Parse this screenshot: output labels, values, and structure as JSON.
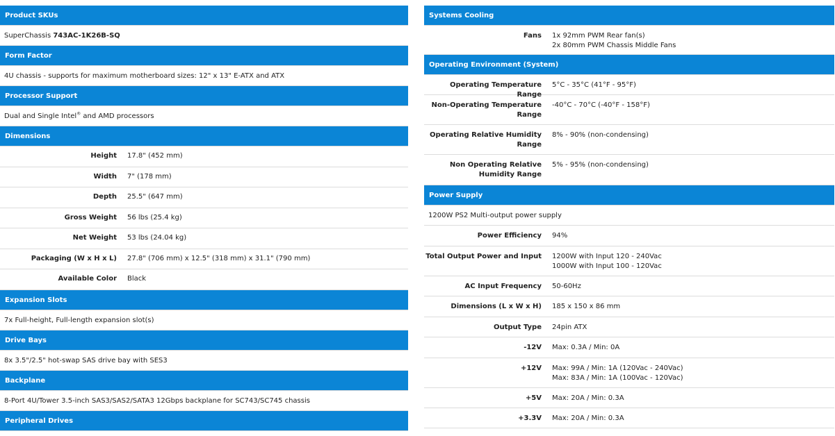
{
  "left": {
    "product_skus": {
      "header": "Product SKUs",
      "prefix": "SuperChassis ",
      "sku": "743AC-1K26B-SQ"
    },
    "form_factor": {
      "header": "Form Factor",
      "text": "4U chassis - supports for maximum motherboard sizes: 12\" x 13\" E-ATX and ATX"
    },
    "processor_support": {
      "header": "Processor Support",
      "text_pre": "Dual and Single Intel",
      "sup": "®",
      "text_post": " and AMD processors"
    },
    "dimensions": {
      "header": "Dimensions",
      "rows": [
        {
          "label": "Height",
          "value": "17.8\" (452 mm)"
        },
        {
          "label": "Width",
          "value": "7\" (178 mm)"
        },
        {
          "label": "Depth",
          "value": "25.5\" (647 mm)"
        },
        {
          "label": "Gross Weight",
          "value": "56 lbs (25.4 kg)"
        },
        {
          "label": "Net Weight",
          "value": "53 lbs (24.04 kg)"
        },
        {
          "label": "Packaging (W x H x L)",
          "value": "27.8\" (706 mm) x 12.5\" (318 mm) x 31.1\" (790 mm)"
        },
        {
          "label": "Available Color",
          "value": "Black"
        }
      ]
    },
    "expansion_slots": {
      "header": "Expansion Slots",
      "text": "7x Full-height, Full-length expansion slot(s)"
    },
    "drive_bays": {
      "header": "Drive Bays",
      "text": "8x 3.5\"/2.5\" hot-swap SAS drive bay with SES3"
    },
    "backplane": {
      "header": "Backplane",
      "text": "8-Port 4U/Tower 3.5-inch SAS3/SAS2/SATA3 12Gbps backplane for SC743/SC745 chassis"
    },
    "peripheral_drives": {
      "header": "Peripheral Drives"
    }
  },
  "right": {
    "systems_cooling": {
      "header": "Systems Cooling",
      "fans_label": "Fans",
      "fans_line1": "1x 92mm PWM Rear fan(s)",
      "fans_line2": "2x 80mm PWM Chassis Middle Fans"
    },
    "operating_environment": {
      "header": "Operating Environment (System)",
      "rows": [
        {
          "label": "Operating Temperature Range",
          "value": "5°C - 35°C (41°F - 95°F)"
        },
        {
          "label": "Non-Operating Temperature Range",
          "value": "-40°C - 70°C (-40°F - 158°F)"
        },
        {
          "label": "Operating Relative Humidity Range",
          "value": "8% - 90% (non-condensing)"
        },
        {
          "label": "Non Operating Relative Humidity Range",
          "value": "5% - 95% (non-condensing)"
        }
      ]
    },
    "power_supply": {
      "header": "Power Supply",
      "text": "1200W PS2 Multi-output power supply",
      "efficiency_label": "Power Efficiency",
      "efficiency_value": "94%",
      "total_label": "Total Output Power and Input",
      "total_line1": "1200W with Input 120 - 240Vac",
      "total_line2": "1000W with Input 100 - 120Vac",
      "ac_label": "AC Input Frequency",
      "ac_value": "50-60Hz",
      "dim_label": "Dimensions (L x W x H)",
      "dim_value": "185 x 150 x 86 mm",
      "output_label": "Output Type",
      "output_value": "24pin ATX",
      "m12_label": "-12V",
      "m12_value": "Max: 0.3A / Min: 0A",
      "p12_label": "+12V",
      "p12_line1": "Max: 99A / Min: 1A (120Vac - 240Vac)",
      "p12_line2": "Max: 83A / Min: 1A (100Vac - 120Vac)",
      "p5_label": "+5V",
      "p5_value": "Max: 20A / Min: 0.3A",
      "p33_label": "+3.3V",
      "p33_value": "Max: 20A / Min: 0.3A"
    }
  },
  "colors": {
    "header_bg": "#0b85d6",
    "header_text": "#ffffff",
    "divider": "#dcdcdc"
  }
}
